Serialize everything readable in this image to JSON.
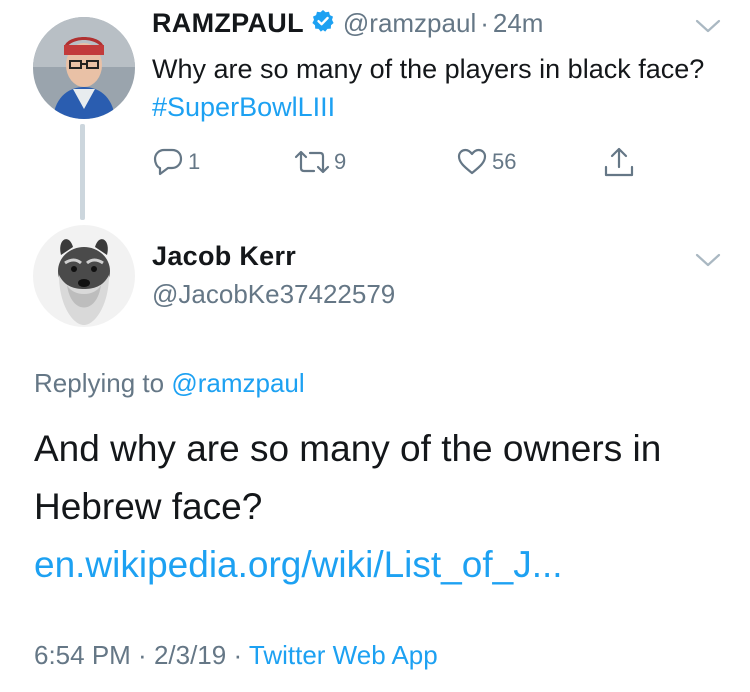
{
  "tweet": {
    "name": "RAMZPAUL",
    "handle": "@ramzpaul",
    "separator": "·",
    "time": "24m",
    "text_before": "Why are so many of the players in black face? ",
    "hashtag": "#SuperBowlLIII",
    "replies": "1",
    "retweets": "9",
    "likes": "56"
  },
  "reply": {
    "name": "Jacob Kerr",
    "handle": "@JacobKe37422579",
    "replying_label": "Replying to ",
    "replying_to": "@ramzpaul",
    "text_before": "And why are so many of the owners in Hebrew face? ",
    "link": "en.wikipedia.org/wiki/List_of_J...",
    "time": "6:54 PM",
    "date": "2/3/19",
    "source": "Twitter Web App"
  },
  "icons": {
    "verified": "verified-badge-icon",
    "reply": "reply-icon",
    "retweet": "retweet-icon",
    "like": "heart-icon",
    "share": "share-icon",
    "more": "chevron-down-icon"
  },
  "colors": {
    "link": "#1da1f2",
    "muted": "#657786",
    "text": "#14171a",
    "verified": "#1da1f2"
  }
}
